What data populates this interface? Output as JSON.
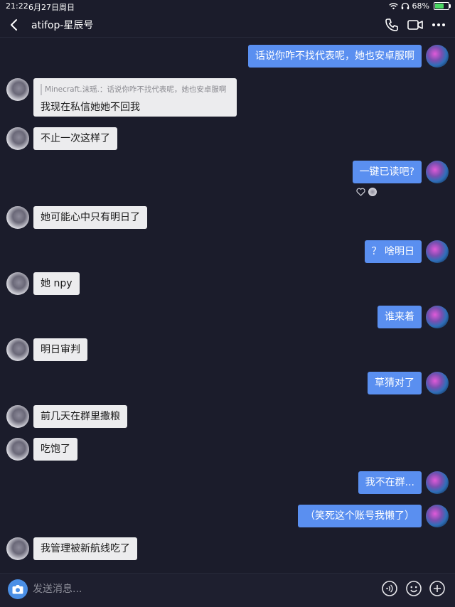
{
  "status_bar": {
    "time": "21:22",
    "date": "6月27日周日",
    "battery": "68%",
    "battery_level": 0.68
  },
  "nav": {
    "title": "atifop-星辰号"
  },
  "quote": {
    "quoted_text": "Minecraft.沫瑶.：话说你咋不找代表呢，她也安卓服啊",
    "reply_text": "我现在私信她她不回我"
  },
  "messages": [
    {
      "side": "out",
      "text": "话说你咋不找代表呢，她也安卓服啊"
    },
    {
      "side": "in",
      "text": "不止一次这样了"
    },
    {
      "side": "out",
      "text": "一键已读吧?"
    },
    {
      "side": "in",
      "text": "她可能心中只有明日了"
    },
    {
      "side": "out",
      "text": "？ 啥明日"
    },
    {
      "side": "in",
      "text": "她 npy"
    },
    {
      "side": "out",
      "text": "谁来着"
    },
    {
      "side": "in",
      "text": "明日审判"
    },
    {
      "side": "out",
      "text": "草猜对了"
    },
    {
      "side": "in",
      "text": "前几天在群里撒粮"
    },
    {
      "side": "in",
      "text": "吃饱了"
    },
    {
      "side": "out",
      "text": "我不在群..."
    },
    {
      "side": "out",
      "text": "（笑死这个账号我懒了）"
    },
    {
      "side": "in",
      "text": "我管理被新航线吃了"
    }
  ],
  "input": {
    "placeholder": "发送消息..."
  },
  "colors": {
    "background": "#1b1c2b",
    "outgoing_bubble": "#5a8ff0",
    "incoming_bubble": "#ececee",
    "accent": "#4a8fe6"
  }
}
